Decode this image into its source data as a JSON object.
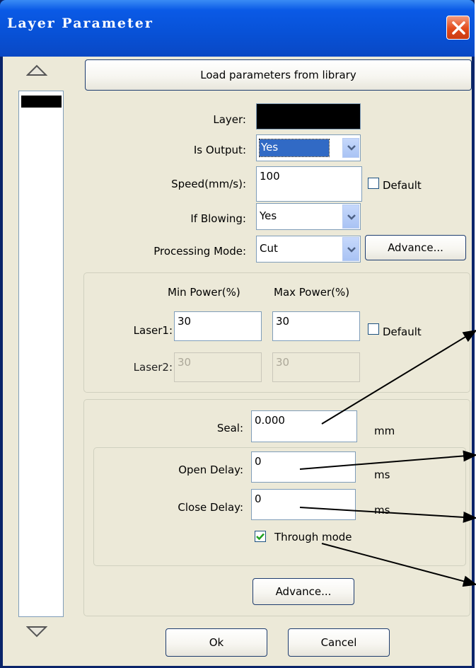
{
  "window": {
    "title": "Layer Parameter"
  },
  "buttons": {
    "load_library": "Load parameters from library",
    "advance_top": "Advance...",
    "advance_bottom": "Advance...",
    "ok": "Ok",
    "cancel": "Cancel"
  },
  "layer_form": {
    "layer_label": "Layer:",
    "layer_color": "#000000",
    "is_output_label": "Is Output:",
    "is_output_value": "Yes",
    "speed_label": "Speed(mm/s):",
    "speed_value": "100",
    "speed_default_label": "Default",
    "if_blowing_label": "If Blowing:",
    "if_blowing_value": "Yes",
    "processing_mode_label": "Processing Mode:",
    "processing_mode_value": "Cut"
  },
  "power": {
    "min_header": "Min Power(%)",
    "max_header": "Max Power(%)",
    "laser1_label": "Laser1:",
    "laser1_min": "30",
    "laser1_max": "30",
    "laser2_label": "Laser2:",
    "laser2_min": "30",
    "laser2_max": "30",
    "default_label": "Default"
  },
  "seal": {
    "seal_label": "Seal:",
    "seal_value": "0.000",
    "seal_unit": "mm",
    "open_delay_label": "Open Delay:",
    "open_delay_value": "0",
    "open_delay_unit": "ms",
    "close_delay_label": "Close Delay:",
    "close_delay_value": "0",
    "close_delay_unit": "ms",
    "through_mode_label": "Through mode",
    "through_mode_checked": true
  },
  "colors": {
    "title_bar": "#0a5ae6",
    "dialog_bg": "#ece9d8",
    "close_button": "#e24a1b",
    "selection": "#316ac5"
  }
}
